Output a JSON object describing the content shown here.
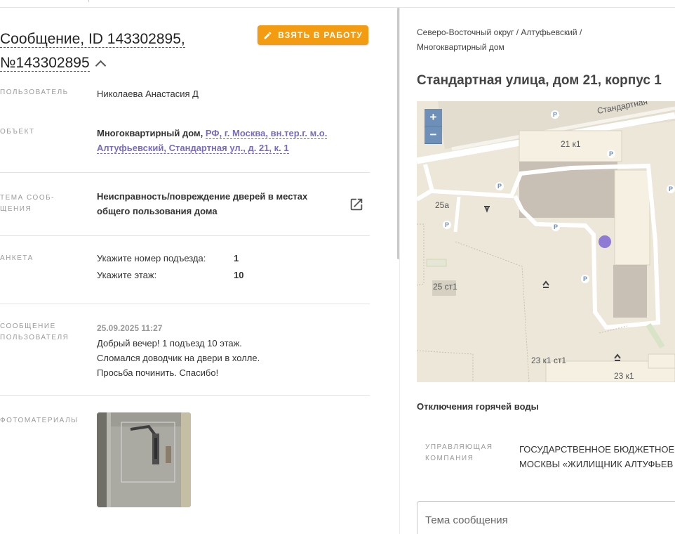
{
  "header": {
    "title_line1": "Сообщение, ID 143302895,",
    "title_line2": "№143302895",
    "take_button": "ВЗЯТЬ В РАБОТУ"
  },
  "details": {
    "user_label": "ПОЛЬЗОВАТЕЛЬ",
    "user_value": "Николаева Анастасия Д",
    "object_label": "ОБЪЕКТ",
    "object_type": "Многоквартирный дом,",
    "object_address_line1": "РФ, г. Москва, вн.тер.г. м.о.",
    "object_address_line2": "Алтуфьевский, Стандартная ул., д. 21, к. 1",
    "topic_label_line1": "ТЕМА СООБ-",
    "topic_label_line2": "ЩЕНИЯ",
    "topic_line1": "Неисправность/повреждение дверей в местах",
    "topic_line2": "общего пользования дома",
    "survey_label": "АНКЕТА",
    "survey": [
      {
        "q": "Укажите номер подъезда:",
        "a": "1"
      },
      {
        "q": "Укажите этаж:",
        "a": "10"
      }
    ],
    "message_label_line1": "СООБЩЕНИЕ",
    "message_label_line2": "ПОЛЬЗОВАТЕЛЯ",
    "message_date": "25.09.2025 11:27",
    "message_line1": "Добрый вечер! 1 подъезд 10 этаж.",
    "message_line2": "Сломался доводчик на двери в холле.",
    "message_line3": "Просьба починить. Спасибо!",
    "photos_label": "ФОТОМАТЕРИАЛЫ"
  },
  "right": {
    "breadcrumb_line1": "Северо-Восточный округ / Алтуфьевский /",
    "breadcrumb_line2": "Многоквартирный дом",
    "address": "Стандартная улица, дом 21, корпус 1",
    "map": {
      "zoom_in": "+",
      "zoom_out": "−",
      "street": "Стандартная",
      "labels": [
        "21 к1",
        "25а",
        "25 ст1",
        "23 к1 ст1",
        "23 к1"
      ],
      "parking": "P"
    },
    "hot_water": "Отключения горячей воды",
    "mc_label_line1": "УПРАВЛЯЮЩАЯ",
    "mc_label_line2": "КОМПАНИЯ",
    "mc_value_line1": "ГОСУДАРСТВЕННОЕ БЮДЖЕТНОЕ",
    "mc_value_line2": "МОСКВЫ «ЖИЛИЩНИК АЛТУФЬЕВ",
    "subject_placeholder": "Тема сообщения"
  },
  "colors": {
    "accent_orange": "#f39c12",
    "link_purple": "#7a6bbf",
    "map_marker": "#8f7bd6",
    "zoom_blue": "#6d8fb8"
  }
}
